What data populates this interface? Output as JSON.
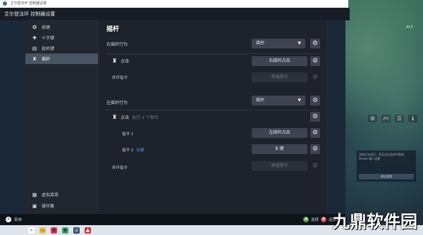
{
  "window": {
    "titlebar_text": "艾尔登法环 控制器设置",
    "header_title": "艾尔登法环 控制器设置"
  },
  "sidebar": {
    "items": [
      {
        "label": "按键",
        "icon": "a-button-icon"
      },
      {
        "label": "十字键",
        "icon": "dpad-icon"
      },
      {
        "label": "扳机键",
        "icon": "trigger-icon"
      },
      {
        "label": "摇杆",
        "icon": "joystick-icon",
        "active": true
      }
    ],
    "bottom_items": [
      {
        "label": "虚拟菜单",
        "icon": "grid-icon"
      },
      {
        "label": "操作集",
        "icon": "layers-icon"
      }
    ]
  },
  "main": {
    "title": "摇杆",
    "right_stick": {
      "behavior_label": "右摇杆行为",
      "behavior_value": "摇杆",
      "click_label": "点击",
      "click_value": "右摇杆点击",
      "outer_label": "外环指令",
      "outer_value": "添加指令"
    },
    "left_stick": {
      "behavior_label": "左摇杆行为",
      "behavior_value": "摇杆",
      "click_label": "点击",
      "click_hint": "执行 2 个指令",
      "cmd1_label": "指令 1",
      "cmd1_value": "左摇杆点击",
      "cmd2_label": "指令 2",
      "cmd2_tag": "长按",
      "cmd2_value": "B 键",
      "outer_label": "外环指令",
      "outer_value": "添加指令"
    }
  },
  "bottom_bar": {
    "left_label": "菜单",
    "right_a": "选择",
    "right_b": "返回"
  },
  "right_panel": {
    "top_label": "ACT",
    "panel_text": "游戏正在运行，您无法在游戏中更改 Steam 输入设置",
    "panel_button": "退出游戏"
  },
  "watermark": "九鼎软件园"
}
